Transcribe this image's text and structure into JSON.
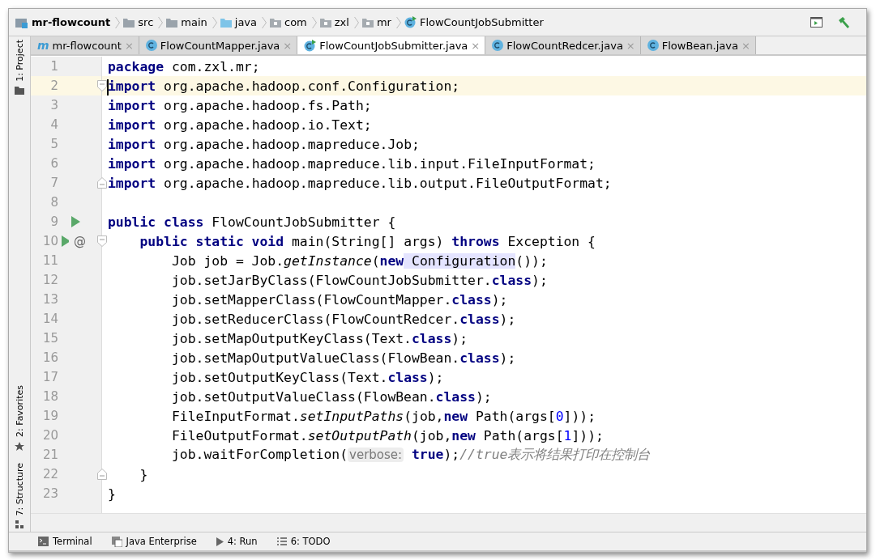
{
  "breadcrumbs": [
    {
      "kind": "module",
      "label": "mr-flowcount"
    },
    {
      "kind": "folder",
      "label": "src"
    },
    {
      "kind": "folder",
      "label": "main"
    },
    {
      "kind": "source",
      "label": "java"
    },
    {
      "kind": "package",
      "label": "com"
    },
    {
      "kind": "package",
      "label": "zxl"
    },
    {
      "kind": "package",
      "label": "mr"
    },
    {
      "kind": "runclass",
      "label": "FlowCountJobSubmitter"
    }
  ],
  "tabs": [
    {
      "kind": "module",
      "icon_text": "m",
      "label": "mr-flowcount",
      "selected": false
    },
    {
      "kind": "class",
      "label": "FlowCountMapper.java",
      "selected": false
    },
    {
      "kind": "runclass",
      "label": "FlowCountJobSubmitter.java",
      "selected": true
    },
    {
      "kind": "class",
      "label": "FlowCountRedcer.java",
      "selected": false
    },
    {
      "kind": "class",
      "label": "FlowBean.java",
      "selected": false
    }
  ],
  "close_mark": "×",
  "side_tools_top": [
    {
      "kind": "folder",
      "label": "1: Project"
    }
  ],
  "side_tools_bottom": [
    {
      "kind": "star",
      "label": "2: Favorites"
    },
    {
      "kind": "structure",
      "label": "7: Structure"
    }
  ],
  "lines": [
    {
      "number": "1",
      "current": false,
      "tokens": [
        {
          "kind": "kw",
          "text": "package"
        },
        {
          "kind": "plain",
          "text": " com.zxl.mr;"
        }
      ]
    },
    {
      "number": "2",
      "current": true,
      "fold_open": true,
      "tokens": [
        {
          "kind": "kw",
          "text": "import"
        },
        {
          "kind": "plain",
          "text": " org.apache.hadoop.conf.Configuration;"
        }
      ]
    },
    {
      "number": "3",
      "current": false,
      "tokens": [
        {
          "kind": "kw",
          "text": "import"
        },
        {
          "kind": "plain",
          "text": " org.apache.hadoop.fs.Path;"
        }
      ]
    },
    {
      "number": "4",
      "current": false,
      "tokens": [
        {
          "kind": "kw",
          "text": "import"
        },
        {
          "kind": "plain",
          "text": " org.apache.hadoop.io.Text;"
        }
      ]
    },
    {
      "number": "5",
      "current": false,
      "tokens": [
        {
          "kind": "kw",
          "text": "import"
        },
        {
          "kind": "plain",
          "text": " org.apache.hadoop.mapreduce.Job;"
        }
      ]
    },
    {
      "number": "6",
      "current": false,
      "tokens": [
        {
          "kind": "kw",
          "text": "import"
        },
        {
          "kind": "plain",
          "text": " org.apache.hadoop.mapreduce.lib.input.FileInputFormat;"
        }
      ]
    },
    {
      "number": "7",
      "current": false,
      "fold_close": true,
      "tokens": [
        {
          "kind": "kw",
          "text": "import"
        },
        {
          "kind": "plain",
          "text": " org.apache.hadoop.mapreduce.lib.output.FileOutputFormat;"
        }
      ]
    },
    {
      "number": "8",
      "current": false
    },
    {
      "number": "9",
      "current": false,
      "run": true,
      "tokens": [
        {
          "kind": "kw",
          "text": "public class"
        },
        {
          "kind": "plain",
          "text": " FlowCountJobSubmitter {"
        }
      ]
    },
    {
      "number": "10",
      "current": false,
      "run": true,
      "annotation": "@",
      "fold_open": true,
      "tokens": [
        {
          "kind": "kw",
          "text": "    public static void"
        },
        {
          "kind": "plain",
          "text": " main(String[] args) "
        },
        {
          "kind": "kw",
          "text": "throws"
        },
        {
          "kind": "plain",
          "text": " Exception {"
        }
      ]
    },
    {
      "number": "11",
      "current": false,
      "tokens": [
        {
          "kind": "plain",
          "text": "        Job job = Job."
        },
        {
          "kind": "method",
          "text": "getInstance"
        },
        {
          "kind": "plain",
          "text": "("
        },
        {
          "kind": "kw",
          "text": "new"
        },
        {
          "kind": "usage",
          "text": " Configuration"
        },
        {
          "kind": "plain",
          "text": "());"
        }
      ]
    },
    {
      "number": "12",
      "current": false,
      "tokens": [
        {
          "kind": "plain",
          "text": "        job.setJarByClass(FlowCountJobSubmitter."
        },
        {
          "kind": "kw",
          "text": "class"
        },
        {
          "kind": "plain",
          "text": ");"
        }
      ]
    },
    {
      "number": "13",
      "current": false,
      "tokens": [
        {
          "kind": "plain",
          "text": "        job.setMapperClass(FlowCountMapper."
        },
        {
          "kind": "kw",
          "text": "class"
        },
        {
          "kind": "plain",
          "text": ");"
        }
      ]
    },
    {
      "number": "14",
      "current": false,
      "tokens": [
        {
          "kind": "plain",
          "text": "        job.setReducerClass(FlowCountRedcer."
        },
        {
          "kind": "kw",
          "text": "class"
        },
        {
          "kind": "plain",
          "text": ");"
        }
      ]
    },
    {
      "number": "15",
      "current": false,
      "tokens": [
        {
          "kind": "plain",
          "text": "        job.setMapOutputKeyClass(Text."
        },
        {
          "kind": "kw",
          "text": "class"
        },
        {
          "kind": "plain",
          "text": ");"
        }
      ]
    },
    {
      "number": "16",
      "current": false,
      "tokens": [
        {
          "kind": "plain",
          "text": "        job.setMapOutputValueClass(FlowBean."
        },
        {
          "kind": "kw",
          "text": "class"
        },
        {
          "kind": "plain",
          "text": ");"
        }
      ]
    },
    {
      "number": "17",
      "current": false,
      "tokens": [
        {
          "kind": "plain",
          "text": "        job.setOutputKeyClass(Text."
        },
        {
          "kind": "kw",
          "text": "class"
        },
        {
          "kind": "plain",
          "text": ");"
        }
      ]
    },
    {
      "number": "18",
      "current": false,
      "tokens": [
        {
          "kind": "plain",
          "text": "        job.setOutputValueClass(FlowBean."
        },
        {
          "kind": "kw",
          "text": "class"
        },
        {
          "kind": "plain",
          "text": ");"
        }
      ]
    },
    {
      "number": "19",
      "current": false,
      "tokens": [
        {
          "kind": "plain",
          "text": "        FileInputFormat."
        },
        {
          "kind": "method",
          "text": "setInputPaths"
        },
        {
          "kind": "plain",
          "text": "(job,"
        },
        {
          "kind": "kw",
          "text": "new"
        },
        {
          "kind": "plain",
          "text": " Path(args["
        },
        {
          "kind": "num",
          "text": "0"
        },
        {
          "kind": "plain",
          "text": "]));"
        }
      ]
    },
    {
      "number": "20",
      "current": false,
      "tokens": [
        {
          "kind": "plain",
          "text": "        FileOutputFormat."
        },
        {
          "kind": "method",
          "text": "setOutputPath"
        },
        {
          "kind": "plain",
          "text": "(job,"
        },
        {
          "kind": "kw",
          "text": "new"
        },
        {
          "kind": "plain",
          "text": " Path(args["
        },
        {
          "kind": "num",
          "text": "1"
        },
        {
          "kind": "plain",
          "text": "]));"
        }
      ]
    },
    {
      "number": "21",
      "current": false,
      "tokens": [
        {
          "kind": "plain",
          "text": "        job.waitForCompletion("
        },
        {
          "kind": "hint",
          "text": "verbose:"
        },
        {
          "kind": "kw",
          "text": " true"
        },
        {
          "kind": "plain",
          "text": ");"
        },
        {
          "kind": "comment",
          "text": "//true表示将结果打印在控制台"
        }
      ]
    },
    {
      "number": "22",
      "current": false,
      "fold_close": true,
      "tokens": [
        {
          "kind": "plain",
          "text": "    }"
        }
      ]
    },
    {
      "number": "23",
      "current": false,
      "tokens": [
        {
          "kind": "plain",
          "text": "}"
        }
      ]
    }
  ],
  "bottom_tools": [
    {
      "kind": "terminal",
      "label": "Terminal"
    },
    {
      "kind": "enterprise",
      "label": "Java Enterprise"
    },
    {
      "kind": "run",
      "label": "4: Run"
    },
    {
      "kind": "todo",
      "label": "6: TODO"
    }
  ]
}
